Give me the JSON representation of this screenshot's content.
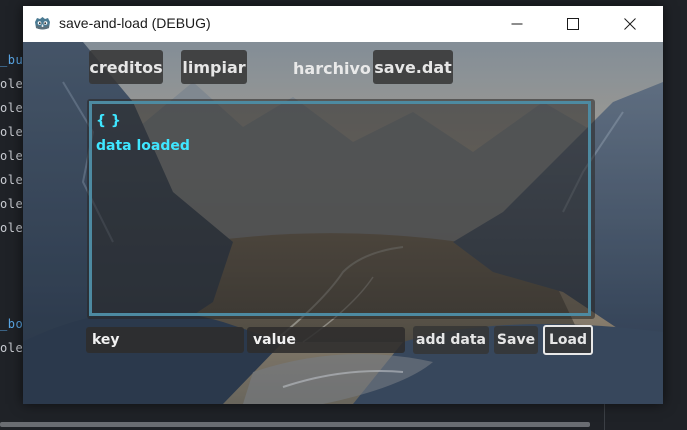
{
  "editor": {
    "lines": [
      "_bu",
      "ole",
      "ole",
      "ole",
      "ole",
      "ole",
      "ole",
      "ole",
      "_bo",
      "ole"
    ]
  },
  "window": {
    "title": "save-and-load (DEBUG)",
    "icon": "godot-icon",
    "controls": [
      "minimize-icon",
      "maximize-icon",
      "close-icon"
    ]
  },
  "toolbar": {
    "creditos_label": "creditos",
    "limpiar_label": "limpiar",
    "harchivo_label": "harchivo",
    "file_label": "save.dat"
  },
  "log": {
    "lines": [
      "{ }",
      "data loaded"
    ]
  },
  "inputs": {
    "key": {
      "value": "key"
    },
    "value": {
      "value": "value"
    }
  },
  "actions": {
    "add_label": "add data",
    "save_label": "Save",
    "load_label": "Load"
  },
  "colors": {
    "log_text": "#3fe6ff",
    "log_border": "#4d8aa1",
    "button_bg": "#363636"
  }
}
